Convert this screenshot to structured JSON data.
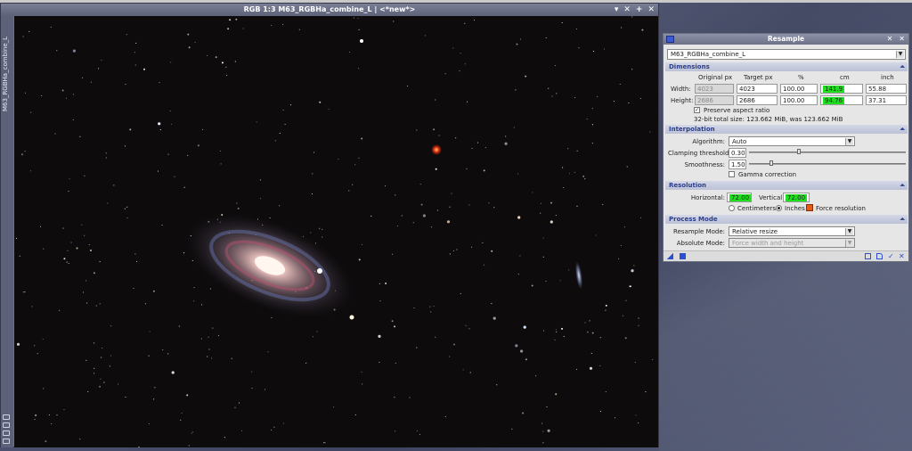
{
  "image_window": {
    "title": "RGB 1:3 M63_RGBHa_combine_L | <*new*>",
    "side_tab_label": "M63_RGBHa_combine_L",
    "buttons": [
      "▾",
      "✕",
      "+",
      "✕"
    ]
  },
  "resample": {
    "title": "Resample",
    "view": "M63_RGBHa_combine_L",
    "dimensions": {
      "header": "Dimensions",
      "columns": [
        "Original px",
        "Target px",
        "%",
        "cm",
        "inch"
      ],
      "width": {
        "label": "Width:",
        "original_px": "4023",
        "target_px": "4023",
        "percent": "100.00",
        "cm": "141.9",
        "inch": "55.88"
      },
      "height": {
        "label": "Height:",
        "original_px": "2686",
        "target_px": "2686",
        "percent": "100.00",
        "cm": "94.76",
        "inch": "37.31"
      },
      "preserve_aspect": {
        "label": "Preserve aspect ratio",
        "checked": true
      },
      "size_info": "32-bit total size: 123.662 MiB, was 123.662 MiB"
    },
    "interpolation": {
      "header": "Interpolation",
      "algorithm_label": "Algorithm:",
      "algorithm": "Auto",
      "clamping_label": "Clamping threshold:",
      "clamping": "0.30",
      "smoothness_label": "Smoothness:",
      "smoothness": "1.50",
      "gamma_label": "Gamma correction",
      "gamma_checked": false
    },
    "resolution": {
      "header": "Resolution",
      "horizontal_label": "Horizontal:",
      "horizontal": "72.00",
      "vertical_label": "Vertical:",
      "vertical": "72.00",
      "units": [
        "Centimeters",
        "Inches"
      ],
      "selected_unit": "Inches",
      "force_label": "Force resolution"
    },
    "process_mode": {
      "header": "Process Mode",
      "resample_mode_label": "Resample Mode:",
      "resample_mode": "Relative resize",
      "absolute_mode_label": "Absolute Mode:",
      "absolute_mode": "Force width and height"
    },
    "colors": {
      "highlight": "#1fe01f",
      "section_text": "#2b3e8c",
      "accent": "#2b4fd0"
    }
  }
}
